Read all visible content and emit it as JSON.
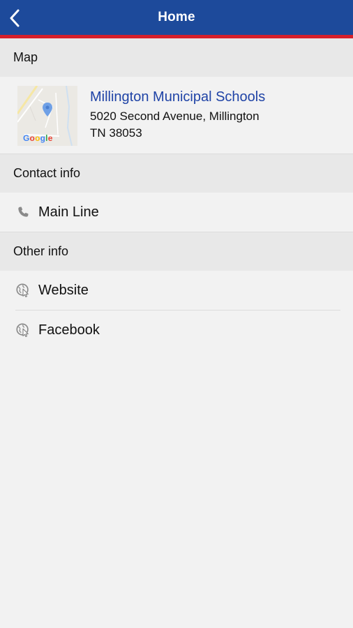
{
  "header": {
    "title": "Home",
    "back_icon": "chevron-left-icon",
    "bar_color": "#1d4a9b",
    "accent_color": "#d61f2b"
  },
  "sections": {
    "map": {
      "heading": "Map",
      "location_name": "Millington Municipal Schools",
      "address_line1": "5020 Second Avenue, Millington",
      "address_line2": "TN 38053",
      "map_brand": "Google",
      "title_color": "#1f43a6"
    },
    "contact": {
      "heading": "Contact info",
      "items": [
        {
          "label": "Main Line",
          "icon": "phone-icon"
        }
      ]
    },
    "other": {
      "heading": "Other info",
      "items": [
        {
          "label": "Website",
          "icon": "globe-cursor-icon"
        },
        {
          "label": "Facebook",
          "icon": "globe-cursor-icon"
        }
      ]
    }
  }
}
